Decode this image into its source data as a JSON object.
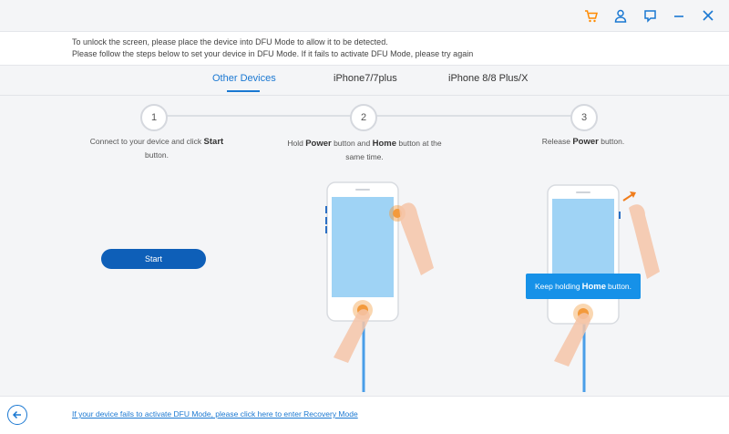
{
  "titlebar": {
    "icons": [
      "cart-icon",
      "user-icon",
      "feedback-icon",
      "minimize-icon",
      "close-icon"
    ],
    "accent_color": "#ff8a00",
    "icon_color": "#1a78d2"
  },
  "info": {
    "line1": "To unlock the screen, please place the device into DFU Mode to allow it to be detected.",
    "line2": "Please follow the steps below to set your device in DFU Mode. If it fails to activate DFU Mode, please try again"
  },
  "tabs": [
    {
      "label": "Other Devices",
      "active": true
    },
    {
      "label": "iPhone7/7plus",
      "active": false
    },
    {
      "label": "iPhone 8/8 Plus/X",
      "active": false
    }
  ],
  "steps": [
    {
      "number": "1",
      "text_pre": "Connect to your device and click ",
      "bold": "Start",
      "text_post": " button."
    },
    {
      "number": "2",
      "text_pre": "Hold ",
      "bold": "Power",
      "text_mid": " button and ",
      "bold2": "Home",
      "text_post": " button at the same time."
    },
    {
      "number": "3",
      "text_pre": "Release ",
      "bold": "Power",
      "text_post": " button."
    }
  ],
  "start_button": "Start",
  "tooltip": {
    "pre": "Keep holding ",
    "bold": "Home",
    "post": " button."
  },
  "bottom": {
    "link": "If your device fails to activate DFU Mode, please click here to enter Recovery Mode"
  },
  "colors": {
    "primary": "#0e5fb8",
    "link": "#1a78d2",
    "tooltip": "#1691e8",
    "finger": "#f5b896",
    "press": "#f39a3c"
  }
}
